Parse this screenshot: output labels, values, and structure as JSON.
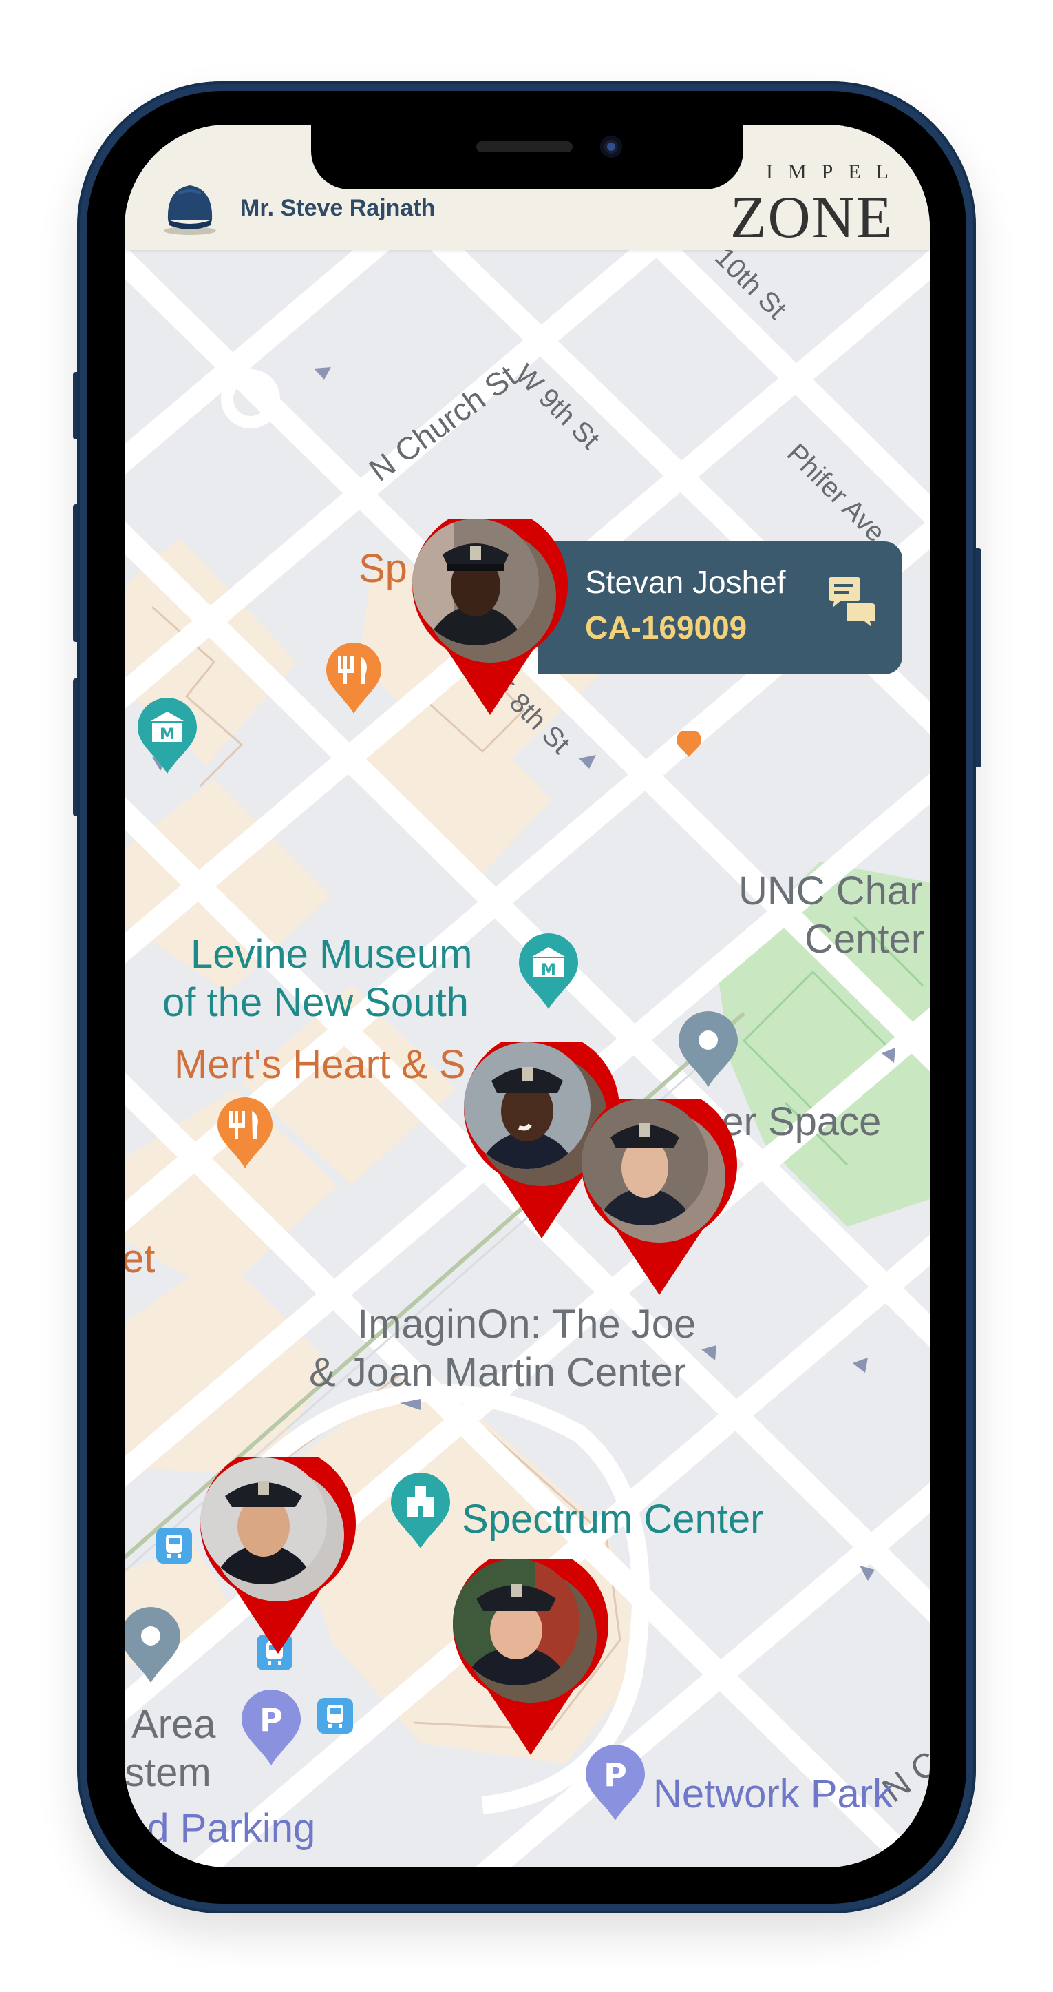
{
  "header": {
    "user_name": "Mr. Steve Rajnath",
    "avatar_icon": "police-cap-icon",
    "logo_top": "IMPEL",
    "logo_main": "ZONE"
  },
  "map": {
    "streets": [
      "N Church St",
      "W 9th St",
      "E 8th St",
      "Phifer Ave",
      "10th St",
      "N C"
    ],
    "places": [
      {
        "name_line1": "Levine Museum",
        "name_line2": "of the New South",
        "type": "museum"
      },
      {
        "name_line1": "Mert's Heart & S",
        "type": "restaurant"
      },
      {
        "name_line1": "UNC Char",
        "name_line2": "Center",
        "type": "building"
      },
      {
        "name_line1": "ner Space",
        "type": "park"
      },
      {
        "name_line1": "ImaginOn: The Joe",
        "name_line2": "& Joan Martin Center",
        "type": "building"
      },
      {
        "name_line1": "Spectrum Center",
        "type": "arena"
      },
      {
        "name_line1": "Network Park",
        "type": "parking"
      },
      {
        "name_line1": "Area",
        "name_line2": "stem",
        "name_line3": "ed Parking",
        "type": "parking"
      },
      {
        "name_line1": "Sp",
        "type": "restaurant"
      },
      {
        "name_line1": "et",
        "type": "restaurant"
      }
    ]
  },
  "selected_officer": {
    "name": "Stevan Joshef",
    "id": "CA-169009",
    "action_icon": "chat-bubbles-icon"
  },
  "officer_pins": [
    {
      "label": "officer-pin-stevan-joshef"
    },
    {
      "label": "officer-pin-2"
    },
    {
      "label": "officer-pin-3"
    },
    {
      "label": "officer-pin-4"
    },
    {
      "label": "officer-pin-5"
    }
  ],
  "colors": {
    "pin_red": "#d40000",
    "callout_bg": "#3c5a6e",
    "callout_id": "#f3d27a",
    "header_bg": "#f2f0e6",
    "frame": "#1f3a5f"
  }
}
